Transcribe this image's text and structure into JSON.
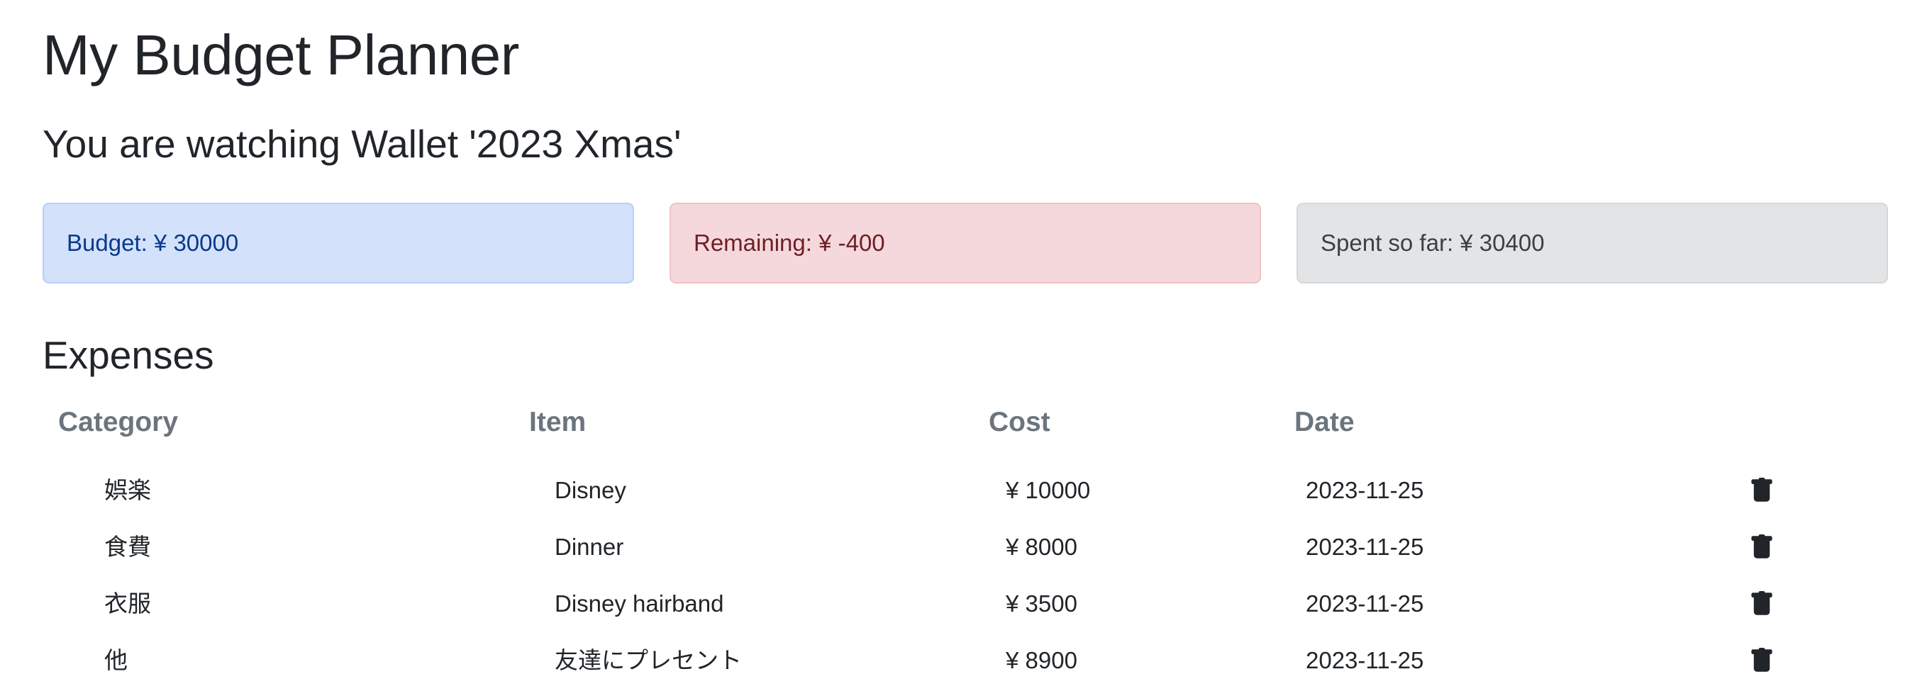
{
  "app": {
    "title": "My Budget Planner"
  },
  "wallet": {
    "heading": "You are watching Wallet '2023 Xmas'"
  },
  "summary": {
    "budget": "Budget: ¥ 30000",
    "remaining": "Remaining: ¥ -400",
    "spent": "Spent so far: ¥ 30400"
  },
  "expenses": {
    "heading": "Expenses",
    "columns": {
      "category": "Category",
      "item": "Item",
      "cost": "Cost",
      "date": "Date"
    },
    "rows": [
      {
        "category": "娯楽",
        "item": "Disney",
        "cost": "¥ 10000",
        "date": "2023-11-25",
        "action_icon": "trash-icon"
      },
      {
        "category": "食費",
        "item": "Dinner",
        "cost": "¥ 8000",
        "date": "2023-11-25",
        "action_icon": "trash-icon"
      },
      {
        "category": "衣服",
        "item": "Disney hairband",
        "cost": "¥ 3500",
        "date": "2023-11-25",
        "action_icon": "trash-icon"
      },
      {
        "category": "他",
        "item": "友達にプレセント",
        "cost": "¥ 8900",
        "date": "2023-11-25",
        "action_icon": "trash-icon"
      }
    ]
  },
  "colors": {
    "budget_bg": "#d3e1fb",
    "budget_text": "#083a8c",
    "remaining_bg": "#f5d8db",
    "remaining_text": "#6e1f26",
    "spent_bg": "#e3e4e5",
    "spent_text": "#3c4045",
    "header_text": "#6c757d"
  }
}
